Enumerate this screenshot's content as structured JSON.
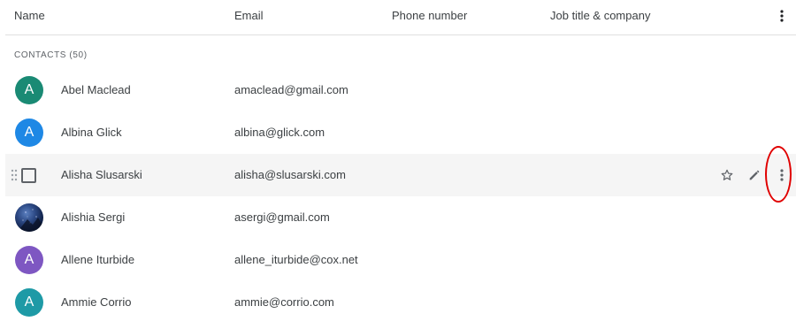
{
  "header": {
    "name": "Name",
    "email": "Email",
    "phone": "Phone number",
    "job": "Job title & company"
  },
  "section": {
    "label": "CONTACTS (50)"
  },
  "contacts": [
    {
      "initial": "A",
      "name": "Abel Maclead",
      "email": "amaclead@gmail.com",
      "color": "#1a8a74"
    },
    {
      "initial": "A",
      "name": "Albina Glick",
      "email": "albina@glick.com",
      "color": "#1e88e5"
    },
    {
      "initial": "",
      "name": "Alisha Slusarski",
      "email": "alisha@slusarski.com",
      "color": ""
    },
    {
      "initial": "",
      "name": "Alishia Sergi",
      "email": "asergi@gmail.com",
      "color": "photo"
    },
    {
      "initial": "A",
      "name": "Allene Iturbide",
      "email": "allene_iturbide@cox.net",
      "color": "#7e57c2"
    },
    {
      "initial": "A",
      "name": "Ammie Corrio",
      "email": "ammie@corrio.com",
      "color": "#1e9aa6"
    }
  ],
  "icons": {
    "header_menu": "more-vert-icon",
    "drag": "drag-handle-icon",
    "star": "star-outline-icon",
    "edit": "pencil-icon",
    "more": "more-vert-icon"
  },
  "annotation_color": "#e00000"
}
